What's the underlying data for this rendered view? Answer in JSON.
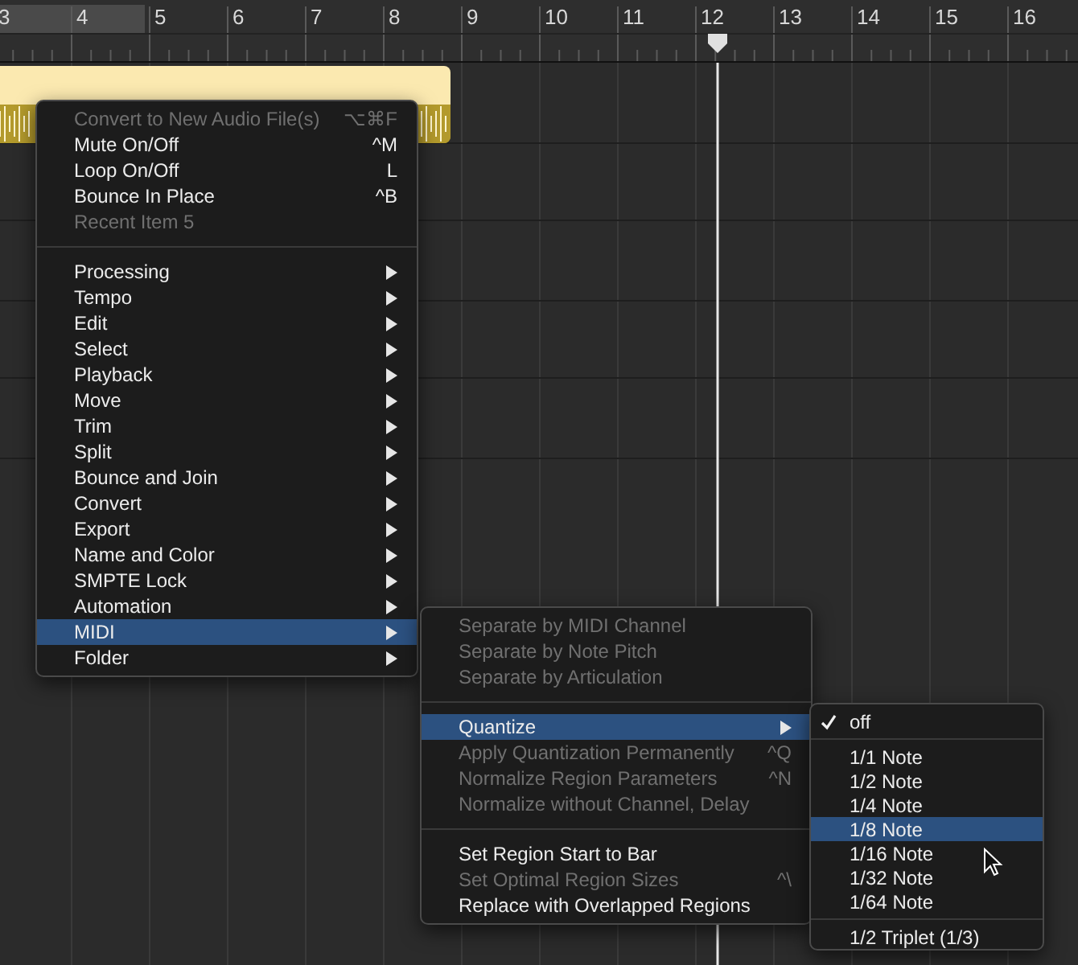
{
  "ruler": {
    "bars": [
      "3",
      "4",
      "5",
      "6",
      "7",
      "8",
      "9",
      "10",
      "11",
      "12",
      "13",
      "14",
      "15",
      "16"
    ]
  },
  "context_menu": {
    "items": [
      {
        "kind": "item",
        "label": "Convert to New Audio File(s)",
        "shortcut": "⌥⌘F",
        "disabled": true,
        "submenu": false,
        "selected": false
      },
      {
        "kind": "item",
        "label": "Mute On/Off",
        "shortcut": "^M",
        "disabled": false,
        "submenu": false,
        "selected": false
      },
      {
        "kind": "item",
        "label": "Loop On/Off",
        "shortcut": "L",
        "disabled": false,
        "submenu": false,
        "selected": false
      },
      {
        "kind": "item",
        "label": "Bounce In Place",
        "shortcut": "^B",
        "disabled": false,
        "submenu": false,
        "selected": false
      },
      {
        "kind": "item",
        "label": "Recent Item 5",
        "disabled": true,
        "submenu": false,
        "selected": false
      },
      {
        "kind": "separator"
      },
      {
        "kind": "item",
        "label": "Processing",
        "disabled": false,
        "submenu": true,
        "selected": false
      },
      {
        "kind": "item",
        "label": "Tempo",
        "disabled": false,
        "submenu": true,
        "selected": false
      },
      {
        "kind": "item",
        "label": "Edit",
        "disabled": false,
        "submenu": true,
        "selected": false
      },
      {
        "kind": "item",
        "label": "Select",
        "disabled": false,
        "submenu": true,
        "selected": false
      },
      {
        "kind": "item",
        "label": "Playback",
        "disabled": false,
        "submenu": true,
        "selected": false
      },
      {
        "kind": "item",
        "label": "Move",
        "disabled": false,
        "submenu": true,
        "selected": false
      },
      {
        "kind": "item",
        "label": "Trim",
        "disabled": false,
        "submenu": true,
        "selected": false
      },
      {
        "kind": "item",
        "label": "Split",
        "disabled": false,
        "submenu": true,
        "selected": false
      },
      {
        "kind": "item",
        "label": "Bounce and Join",
        "disabled": false,
        "submenu": true,
        "selected": false
      },
      {
        "kind": "item",
        "label": "Convert",
        "disabled": false,
        "submenu": true,
        "selected": false
      },
      {
        "kind": "item",
        "label": "Export",
        "disabled": false,
        "submenu": true,
        "selected": false
      },
      {
        "kind": "item",
        "label": "Name and Color",
        "disabled": false,
        "submenu": true,
        "selected": false
      },
      {
        "kind": "item",
        "label": "SMPTE Lock",
        "disabled": false,
        "submenu": true,
        "selected": false
      },
      {
        "kind": "item",
        "label": "Automation",
        "disabled": false,
        "submenu": true,
        "selected": false
      },
      {
        "kind": "item",
        "label": "MIDI",
        "disabled": false,
        "submenu": true,
        "selected": true
      },
      {
        "kind": "item",
        "label": "Folder",
        "disabled": false,
        "submenu": true,
        "selected": false
      }
    ]
  },
  "midi_submenu": {
    "items": [
      {
        "kind": "item",
        "label": "Separate by MIDI Channel",
        "disabled": true,
        "submenu": false,
        "selected": false
      },
      {
        "kind": "item",
        "label": "Separate by Note Pitch",
        "disabled": true,
        "submenu": false,
        "selected": false
      },
      {
        "kind": "item",
        "label": "Separate by Articulation",
        "disabled": true,
        "submenu": false,
        "selected": false
      },
      {
        "kind": "separator"
      },
      {
        "kind": "item",
        "label": "Quantize",
        "disabled": false,
        "submenu": true,
        "selected": true
      },
      {
        "kind": "item",
        "label": "Apply Quantization Permanently",
        "shortcut": "^Q",
        "disabled": true,
        "submenu": false,
        "selected": false
      },
      {
        "kind": "item",
        "label": "Normalize Region Parameters",
        "shortcut": "^N",
        "disabled": true,
        "submenu": false,
        "selected": false
      },
      {
        "kind": "item",
        "label": "Normalize without Channel, Delay",
        "disabled": true,
        "submenu": false,
        "selected": false
      },
      {
        "kind": "separator"
      },
      {
        "kind": "item",
        "label": "Set Region Start to Bar",
        "disabled": false,
        "submenu": false,
        "selected": false
      },
      {
        "kind": "item",
        "label": "Set Optimal Region Sizes",
        "shortcut": "^\\",
        "disabled": true,
        "submenu": false,
        "selected": false
      },
      {
        "kind": "item",
        "label": "Replace with Overlapped Regions",
        "disabled": false,
        "submenu": false,
        "selected": false
      }
    ]
  },
  "quantize_submenu": {
    "items": [
      {
        "kind": "item",
        "label": "off",
        "checked": true,
        "selected": false
      },
      {
        "kind": "separator"
      },
      {
        "kind": "item",
        "label": "1/1 Note",
        "checked": false,
        "selected": false
      },
      {
        "kind": "item",
        "label": "1/2 Note",
        "checked": false,
        "selected": false
      },
      {
        "kind": "item",
        "label": "1/4 Note",
        "checked": false,
        "selected": false
      },
      {
        "kind": "item",
        "label": "1/8 Note",
        "checked": false,
        "selected": true
      },
      {
        "kind": "item",
        "label": "1/16 Note",
        "checked": false,
        "selected": false
      },
      {
        "kind": "item",
        "label": "1/32 Note",
        "checked": false,
        "selected": false
      },
      {
        "kind": "item",
        "label": "1/64 Note",
        "checked": false,
        "selected": false
      },
      {
        "kind": "separator"
      },
      {
        "kind": "item",
        "label": "1/2 Triplet (1/3)",
        "checked": false,
        "selected": false
      }
    ]
  }
}
